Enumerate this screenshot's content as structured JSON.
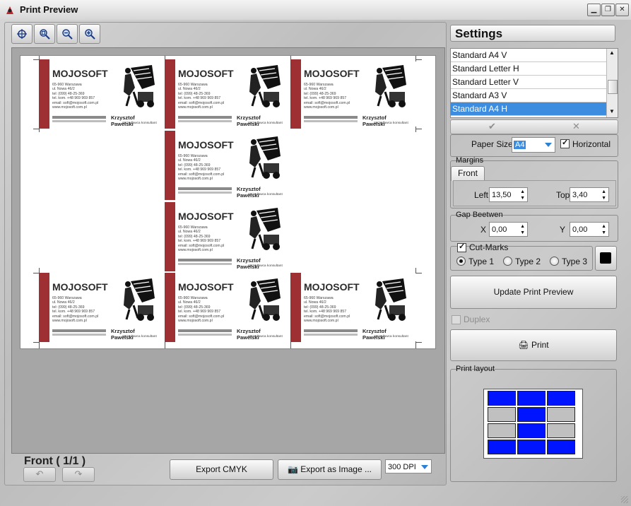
{
  "window": {
    "title": "Print Preview"
  },
  "toolbar": {
    "icons": [
      "zoom-fit-icon",
      "zoom-page-icon",
      "zoom-out-icon",
      "zoom-in-icon"
    ]
  },
  "card": {
    "company": "MOJOSOFT",
    "address_lines": [
      "65-960 Warszawa",
      "ul. Nowa 46/2",
      "tel: (099) 48-25-369",
      "tel. kom. +48 969 969 857",
      "email: soft@mojosoft.com.pl",
      "www.mojosoft.com.pl"
    ],
    "person": "Krzysztof Pawelski",
    "role": "sprzedawca konsultant",
    "stripe_color": "#9e2f33"
  },
  "preview": {
    "front_label": "Front ( 1/1 )",
    "export_cmyk": "Export CMYK",
    "export_image": "Export as Image ...",
    "dpi": "300 DPI"
  },
  "settings": {
    "title": "Settings",
    "formats": [
      "Standard A4 V",
      "Standard Letter H",
      "Standard Letter V",
      "Standard A3 V",
      "Standard A4 H"
    ],
    "selected_format": "Standard A4 H",
    "ok_symbol": "✔",
    "cancel_symbol": "✕",
    "paper_size_label": "Paper Size",
    "paper_size_value": "A4",
    "horizontal_label": "Horizontal",
    "horizontal_checked": true,
    "margins": {
      "title": "Margins",
      "tab": "Front",
      "left_label": "Left",
      "left_value": "13,50",
      "top_label": "Top",
      "top_value": "3,40"
    },
    "gap": {
      "title": "Gap Beetwen",
      "x_label": "X",
      "x_value": "0,00",
      "y_label": "Y",
      "y_value": "0,00"
    },
    "cutmarks": {
      "label": "Cut-Marks",
      "checked": true,
      "type1": "Type 1",
      "type2": "Type 2",
      "type3": "Type 3",
      "selected": "Type 1",
      "color": "#000000"
    },
    "update_button": "Update Print Preview",
    "duplex_label": "Duplex",
    "print_button": "Print",
    "print_layout_title": "Print layout",
    "layout_colors": {
      "filled": "#0014ff",
      "empty": "#c0c0c0"
    }
  }
}
